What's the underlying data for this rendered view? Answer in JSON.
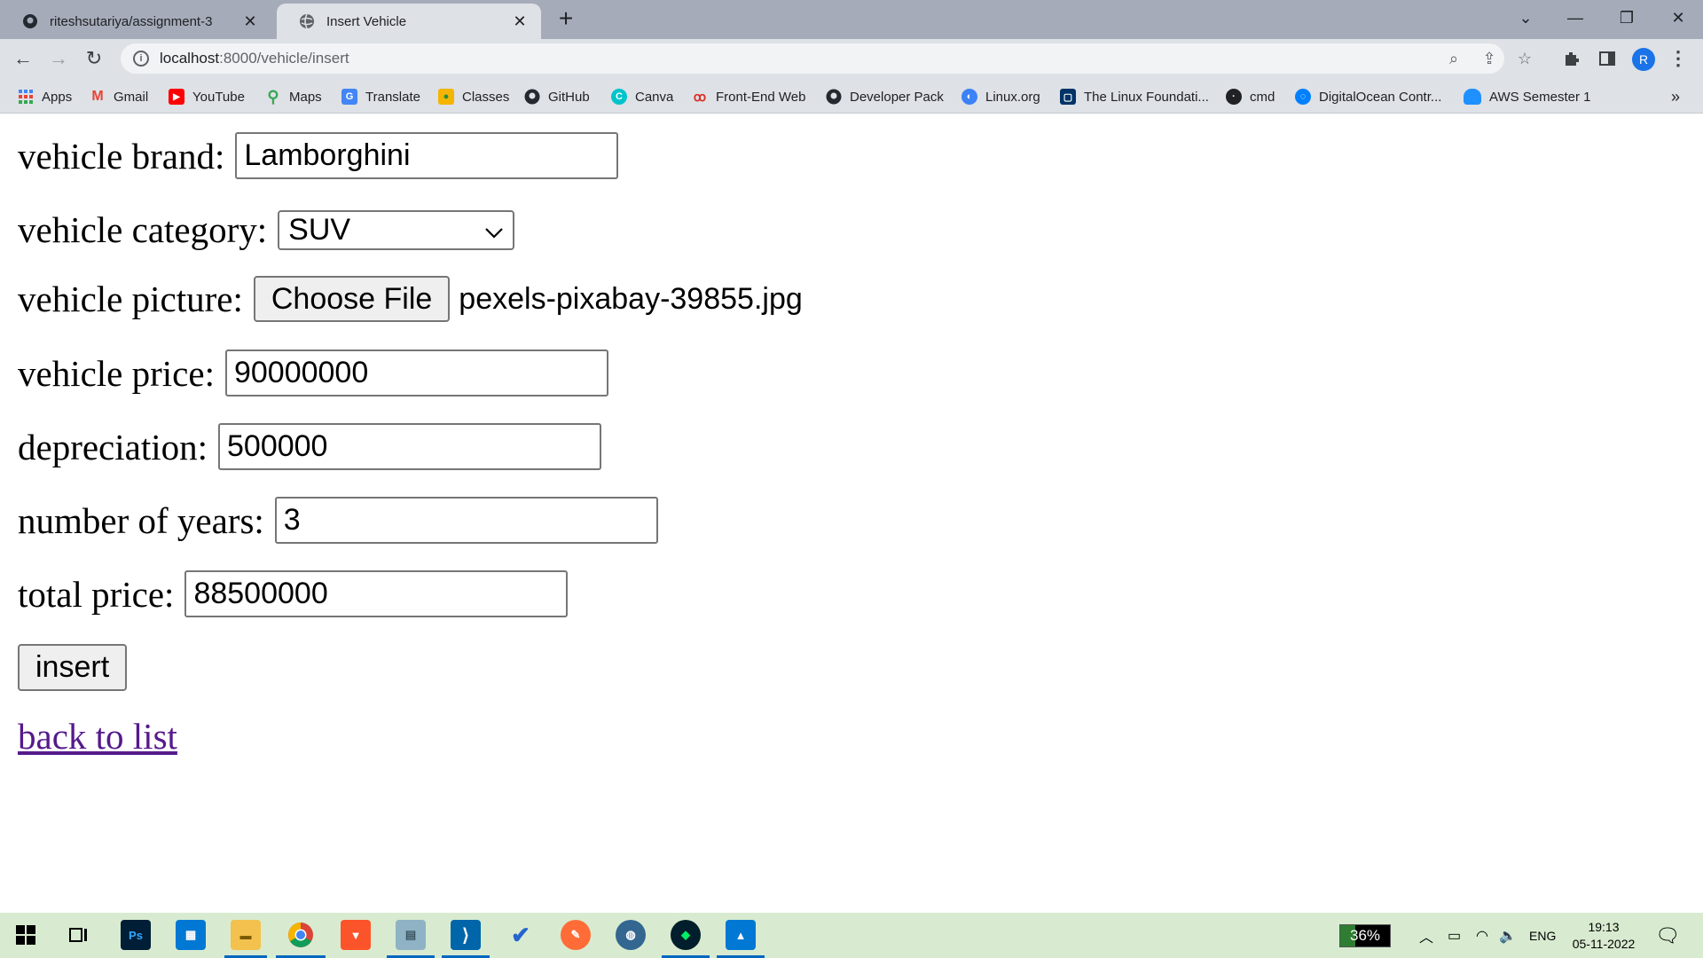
{
  "browser": {
    "tabs": [
      {
        "title": "riteshsutariya/assignment-3",
        "icon": "github-icon"
      },
      {
        "title": "Insert Vehicle",
        "icon": "globe-icon"
      }
    ],
    "url_host": "localhost",
    "url_path": ":8000/vehicle/insert",
    "profile_initial": "R",
    "bookmarks": [
      {
        "label": "Apps",
        "icon": "apps-grid-icon"
      },
      {
        "label": "Gmail",
        "icon": "gmail-icon"
      },
      {
        "label": "YouTube",
        "icon": "youtube-icon"
      },
      {
        "label": "Maps",
        "icon": "maps-icon"
      },
      {
        "label": "Translate",
        "icon": "translate-icon"
      },
      {
        "label": "Classes",
        "icon": "classroom-icon"
      },
      {
        "label": "GitHub",
        "icon": "github-icon"
      },
      {
        "label": "Canva",
        "icon": "canva-icon"
      },
      {
        "label": "Front-End Web",
        "icon": "frontend-icon"
      },
      {
        "label": "Developer Pack",
        "icon": "github-icon"
      },
      {
        "label": "Linux.org",
        "icon": "linux-icon"
      },
      {
        "label": "The Linux Foundati...",
        "icon": "linux-foundation-icon"
      },
      {
        "label": "cmd",
        "icon": "cmd-icon"
      },
      {
        "label": "DigitalOcean Contr...",
        "icon": "digitalocean-icon"
      },
      {
        "label": "AWS Semester 1",
        "icon": "aws-icon"
      }
    ],
    "overflow": "»"
  },
  "form": {
    "brand_label": "vehicle brand:",
    "brand_value": "Lamborghini",
    "category_label": "vehicle category:",
    "category_value": "SUV",
    "picture_label": "vehicle picture:",
    "choose_file": "Choose File",
    "file_name": "pexels-pixabay-39855.jpg",
    "price_label": "vehicle price:",
    "price_value": "90000000",
    "depreciation_label": "depreciation:",
    "depreciation_value": "500000",
    "years_label": "number of years:",
    "years_value": "3",
    "total_label": "total price:",
    "total_value": "88500000",
    "insert_button": "insert",
    "back_link": "back to list"
  },
  "taskbar": {
    "battery": "36%",
    "language": "ENG",
    "time": "19:13",
    "date": "05-11-2022"
  }
}
